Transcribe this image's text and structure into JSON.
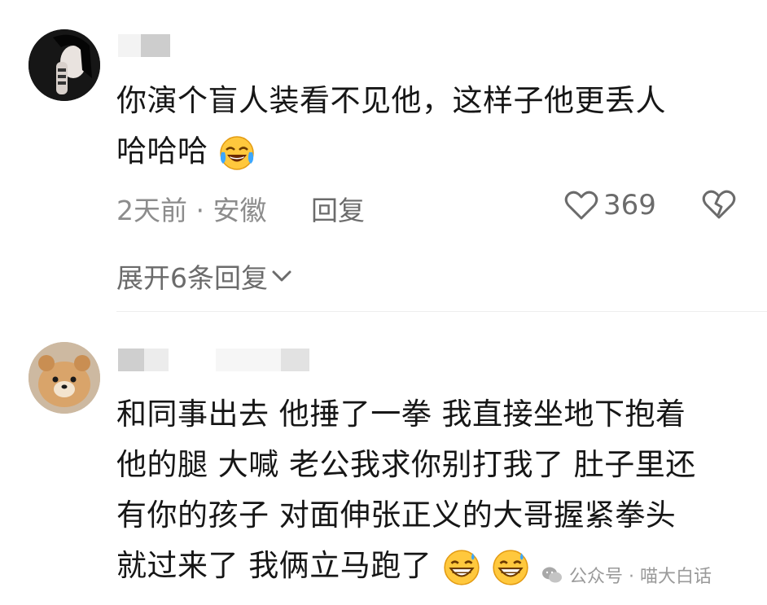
{
  "comment1": {
    "lines": [
      "你演个盲人装看不见他，这样子他更丢人",
      "哈哈哈"
    ],
    "emoji": "laughing-crying-emoji",
    "time_location": "2天前 · 安徽",
    "reply_label": "回复",
    "like_count": "369",
    "expand_label": "展开6条回复"
  },
  "comment2": {
    "lines": [
      "和同事出去 他捶了一拳 我直接坐地下抱着",
      "他的腿 大喊 老公我求你别打我了 肚子里还",
      "有你的孩子 对面伸张正义的大哥握紧拳头",
      "就过来了 我俩立马跑了"
    ],
    "emoji": "grinning-sweat-emoji"
  },
  "watermark": {
    "text": "公众号 · 喵大白话"
  }
}
